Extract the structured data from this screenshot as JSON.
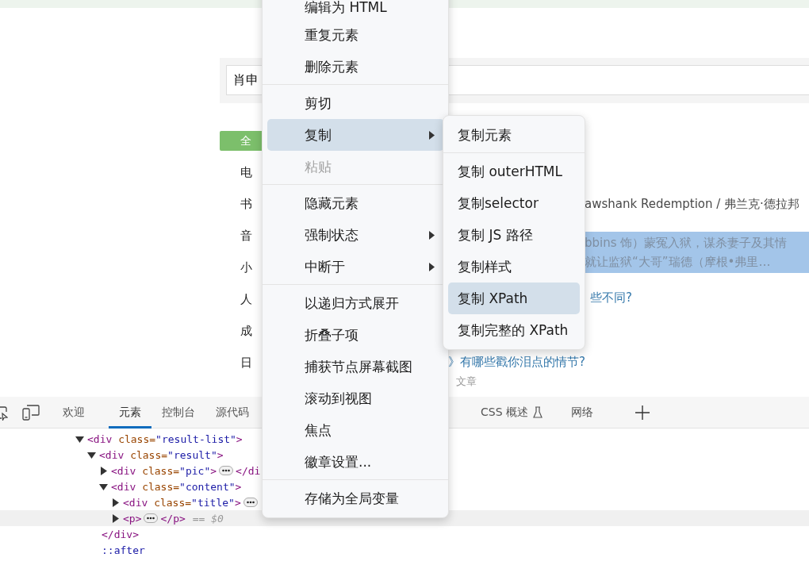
{
  "search": {
    "value": "肖申"
  },
  "all_button": {
    "label": "全"
  },
  "categories": [
    "电",
    "书",
    "音",
    "小",
    "人",
    "成",
    "日"
  ],
  "results": [
    {
      "kind": "subtitle",
      "lines": [
        "awshank Redemption / 弗兰克·德拉邦"
      ]
    },
    {
      "kind": "summary",
      "lines": [
        "bbins 饰）蒙冤入狱，谋杀妻子及其情",
        "就让监狱“大哥”瑞德（摩根•弗里…"
      ]
    },
    {
      "kind": "link",
      "lines": [
        "些不同?"
      ]
    },
    {
      "kind": "link",
      "lines": [
        "》有哪些戳你泪点的情节?"
      ]
    },
    {
      "kind": "meta",
      "lines": [
        "文章"
      ]
    }
  ],
  "devtools": {
    "tabs": [
      {
        "kind": "inspect"
      },
      {
        "kind": "device"
      },
      {
        "kind": "text",
        "label": "欢迎",
        "selected": false
      },
      {
        "kind": "text",
        "label": "元素",
        "selected": true
      },
      {
        "kind": "text",
        "label": "控制台",
        "selected": false
      },
      {
        "kind": "text",
        "label": "源代码",
        "selected": false
      },
      {
        "kind": "text",
        "label": "CSS 概述",
        "flask": true,
        "selected": false
      },
      {
        "kind": "text",
        "label": "网络",
        "selected": false
      },
      {
        "kind": "add"
      }
    ],
    "tree": [
      {
        "kind": "element",
        "expanded": true,
        "selected": false,
        "tokens": [
          {
            "kind": "tag",
            "text": "<div"
          },
          {
            "kind": "attr",
            "text": " class="
          },
          {
            "kind": "value",
            "text": "\"result-list\""
          },
          {
            "kind": "tag",
            "text": ">"
          }
        ],
        "children": [
          {
            "kind": "element",
            "expanded": true,
            "selected": false,
            "tokens": [
              {
                "kind": "tag",
                "text": "<div"
              },
              {
                "kind": "attr",
                "text": " class="
              },
              {
                "kind": "value",
                "text": "\"result\""
              },
              {
                "kind": "tag",
                "text": ">"
              }
            ],
            "children": [
              {
                "kind": "element",
                "expanded": false,
                "selected": false,
                "tokens": [
                  {
                    "kind": "tag",
                    "text": "<div"
                  },
                  {
                    "kind": "attr",
                    "text": " class="
                  },
                  {
                    "kind": "value",
                    "text": "\"pic\""
                  },
                  {
                    "kind": "tag",
                    "text": ">"
                  }
                ],
                "after": [
                  {
                    "kind": "tag",
                    "text": "</di"
                  }
                ]
              },
              {
                "kind": "element",
                "expanded": true,
                "selected": false,
                "tokens": [
                  {
                    "kind": "tag",
                    "text": "<div"
                  },
                  {
                    "kind": "attr",
                    "text": " class="
                  },
                  {
                    "kind": "value",
                    "text": "\"content\""
                  },
                  {
                    "kind": "tag",
                    "text": ">"
                  }
                ],
                "children": [
                  {
                    "kind": "element",
                    "expanded": false,
                    "selected": false,
                    "tokens": [
                      {
                        "kind": "tag",
                        "text": "<div"
                      },
                      {
                        "kind": "attr",
                        "text": " class="
                      },
                      {
                        "kind": "value",
                        "text": "\"title\""
                      },
                      {
                        "kind": "tag",
                        "text": ">"
                      }
                    ]
                  },
                  {
                    "kind": "element",
                    "expanded": false,
                    "selected": true,
                    "tokens": [
                      {
                        "kind": "tag",
                        "text": "<p>"
                      }
                    ],
                    "after": [
                      {
                        "kind": "tag",
                        "text": "</p>"
                      }
                    ],
                    "note": "== $0"
                  }
                ]
              },
              {
                "kind": "text",
                "selected": false,
                "tokens": [
                  {
                    "kind": "tag",
                    "text": "</div>"
                  }
                ]
              },
              {
                "kind": "text",
                "selected": false,
                "tokens": [
                  {
                    "kind": "pseudo",
                    "text": "::after"
                  }
                ]
              }
            ]
          }
        ]
      }
    ]
  },
  "context_menu": {
    "items": [
      {
        "kind": "item",
        "label": "编辑为 HTML",
        "selected": false,
        "disabled": false,
        "submenu": false
      },
      {
        "kind": "item",
        "label": "重复元素",
        "selected": false,
        "disabled": false,
        "submenu": false
      },
      {
        "kind": "item",
        "label": "删除元素",
        "selected": false,
        "disabled": false,
        "submenu": false
      },
      {
        "kind": "separator"
      },
      {
        "kind": "item",
        "label": "剪切",
        "selected": false,
        "disabled": false,
        "submenu": false
      },
      {
        "kind": "item",
        "label": "复制",
        "selected": true,
        "disabled": false,
        "submenu": true
      },
      {
        "kind": "item",
        "label": "粘贴",
        "selected": false,
        "disabled": true,
        "submenu": false
      },
      {
        "kind": "separator"
      },
      {
        "kind": "item",
        "label": "隐藏元素",
        "selected": false,
        "disabled": false,
        "submenu": false
      },
      {
        "kind": "item",
        "label": "强制状态",
        "selected": false,
        "disabled": false,
        "submenu": true
      },
      {
        "kind": "item",
        "label": "中断于",
        "selected": false,
        "disabled": false,
        "submenu": true
      },
      {
        "kind": "separator"
      },
      {
        "kind": "item",
        "label": "以递归方式展开",
        "selected": false,
        "disabled": false,
        "submenu": false
      },
      {
        "kind": "item",
        "label": "折叠子项",
        "selected": false,
        "disabled": false,
        "submenu": false
      },
      {
        "kind": "item",
        "label": "捕获节点屏幕截图",
        "selected": false,
        "disabled": false,
        "submenu": false
      },
      {
        "kind": "item",
        "label": "滚动到视图",
        "selected": false,
        "disabled": false,
        "submenu": false
      },
      {
        "kind": "item",
        "label": "焦点",
        "selected": false,
        "disabled": false,
        "submenu": false
      },
      {
        "kind": "item",
        "label": "徽章设置...",
        "selected": false,
        "disabled": false,
        "submenu": false
      },
      {
        "kind": "separator"
      },
      {
        "kind": "item",
        "label": "存储为全局变量",
        "selected": false,
        "disabled": false,
        "submenu": false
      }
    ]
  },
  "submenu": {
    "items": [
      {
        "kind": "item",
        "label": "复制元素",
        "selected": false
      },
      {
        "kind": "separator"
      },
      {
        "kind": "item",
        "label": "复制 outerHTML",
        "selected": false
      },
      {
        "kind": "item",
        "label": "复制selector",
        "selected": false
      },
      {
        "kind": "item",
        "label": "复制 JS 路径",
        "selected": false
      },
      {
        "kind": "item",
        "label": "复制样式",
        "selected": false
      },
      {
        "kind": "item",
        "label": "复制 XPath",
        "selected": true
      },
      {
        "kind": "item",
        "label": "复制完整的 XPath",
        "selected": false
      }
    ]
  }
}
